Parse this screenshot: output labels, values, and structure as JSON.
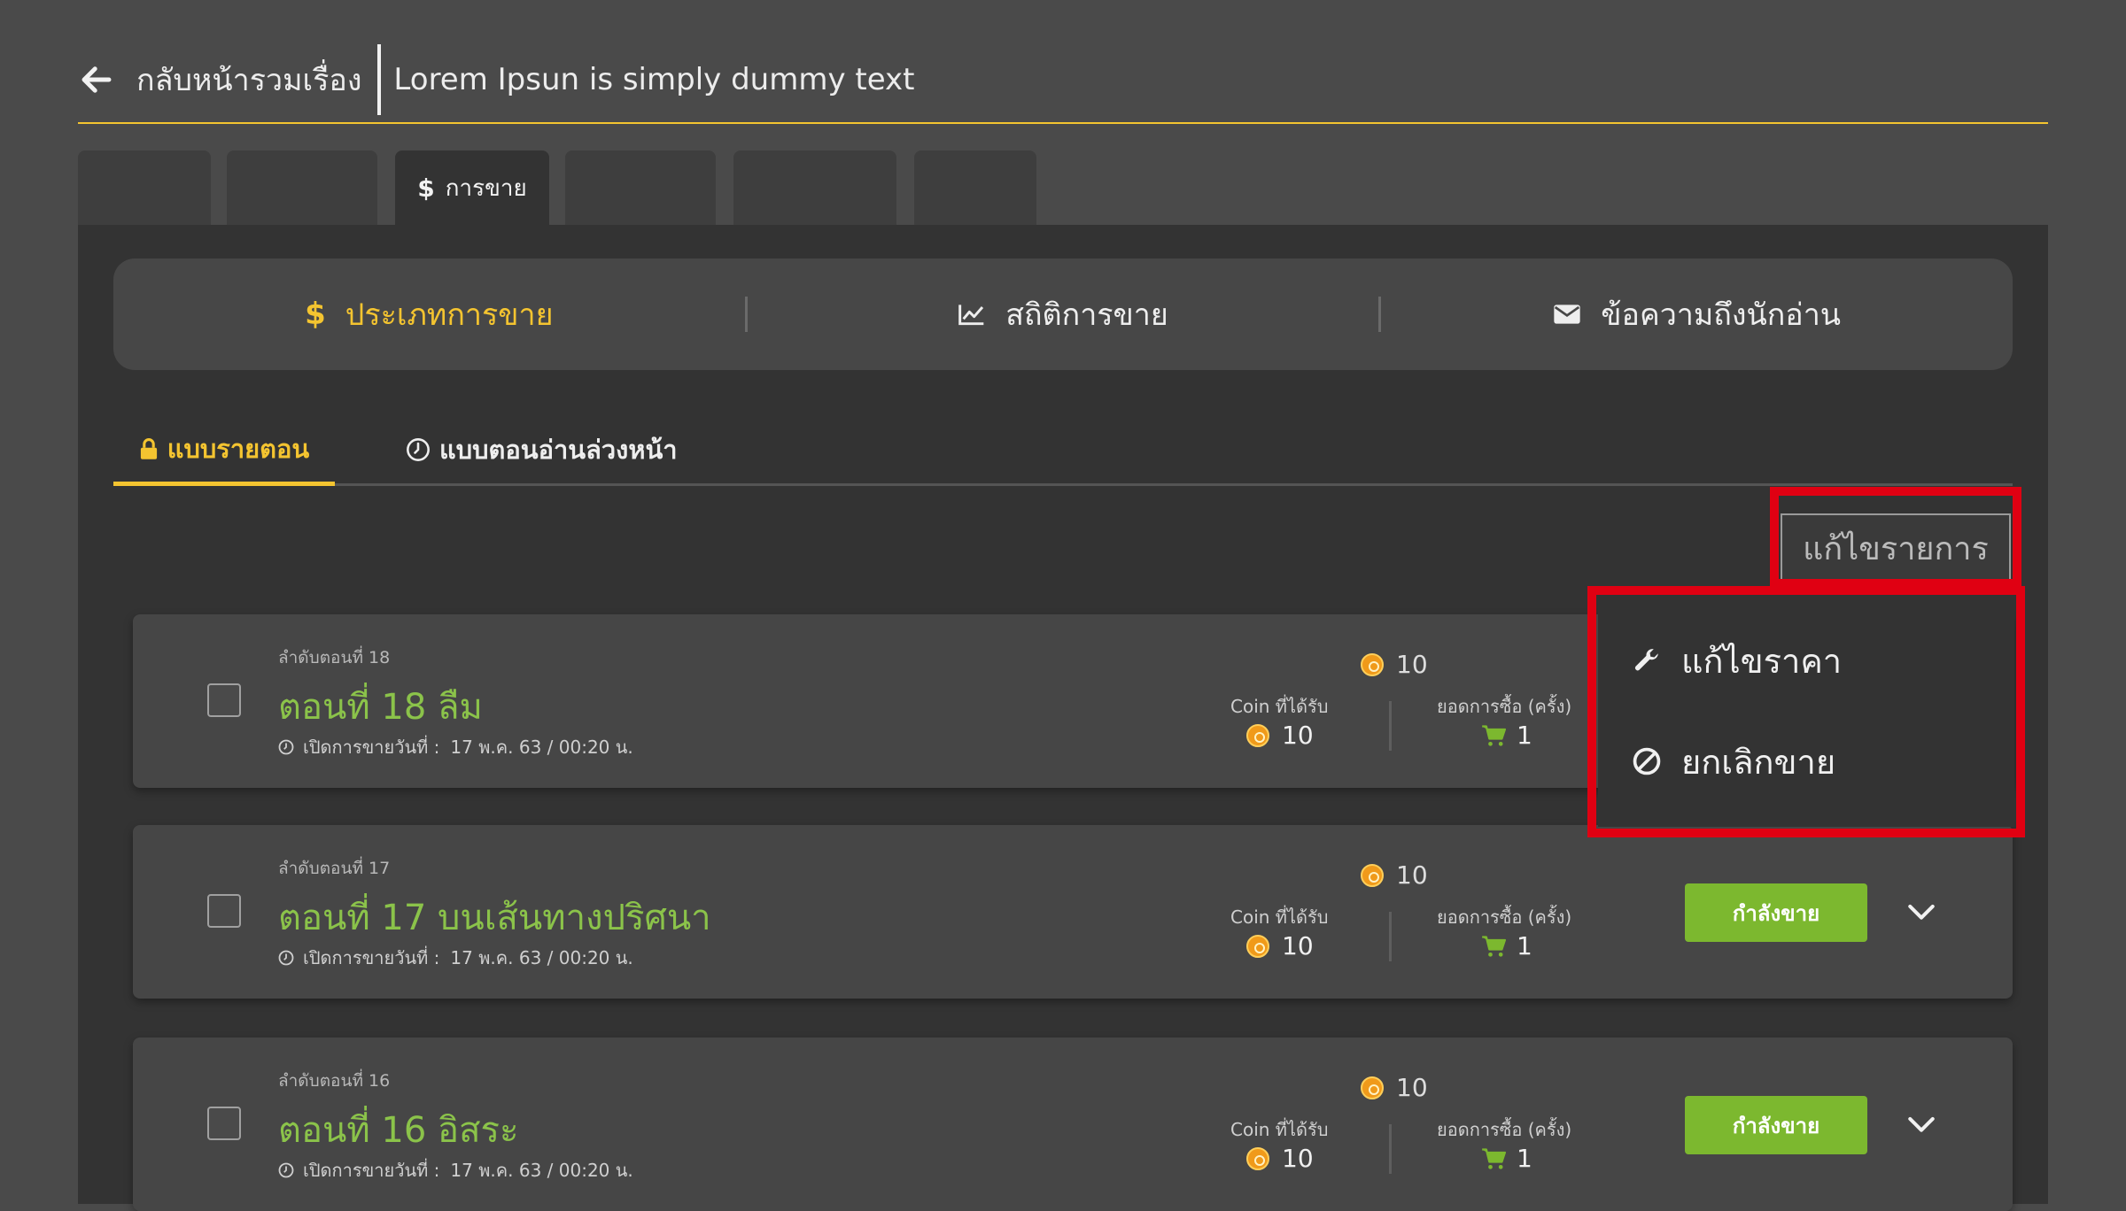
{
  "header": {
    "back_label": "กลับหน้ารวมเรื่อง",
    "title": "Lorem Ipsun is simply dummy text"
  },
  "tabs": [
    {
      "label": ""
    },
    {
      "label": ""
    },
    {
      "label": "การขาย",
      "active": true
    },
    {
      "label": ""
    },
    {
      "label": ""
    },
    {
      "label": ""
    }
  ],
  "segmented": {
    "items": [
      {
        "label": "ประเภทการขาย",
        "icon": "dollar-icon",
        "active": true
      },
      {
        "label": "สถิติการขาย",
        "icon": "chart-icon"
      },
      {
        "label": "ข้อความถึงนักอ่าน",
        "icon": "envelope-icon"
      }
    ]
  },
  "subtabs": [
    {
      "label": "แบบรายตอน",
      "icon": "lock-icon",
      "active": true
    },
    {
      "label": "แบบตอนอ่านล่วงหน้า",
      "icon": "clock-icon"
    }
  ],
  "edit_button": "แก้ไขรายการ",
  "edit_menu": [
    {
      "label": "แก้ไขราคา",
      "icon": "wrench-icon"
    },
    {
      "label": "ยกเลิกขาย",
      "icon": "ban-icon"
    }
  ],
  "labels": {
    "coin_received": "Coin ที่ได้รับ",
    "purchase_count": "ยอดการซื้อ (ครั้ง)",
    "open_date": "เปิดการขายวันที่ :",
    "selling": "กำลังขาย"
  },
  "episodes": [
    {
      "order": "ลำดับตอนที่ 18",
      "title": "ตอนที่ 18 ลืม",
      "date": "17 พ.ค. 63 / 00:20 น.",
      "price": "10",
      "coin": "10",
      "purchases": "1",
      "status": ""
    },
    {
      "order": "ลำดับตอนที่ 17",
      "title": "ตอนที่ 17 บนเส้นทางปริศนา",
      "date": "17 พ.ค. 63 / 00:20 น.",
      "price": "10",
      "coin": "10",
      "purchases": "1",
      "status": "กำลังขาย"
    },
    {
      "order": "ลำดับตอนที่ 16",
      "title": "ตอนที่ 16 อิสระ",
      "date": "17 พ.ค. 63 / 00:20 น.",
      "price": "10",
      "coin": "10",
      "purchases": "1",
      "status": "กำลังขาย"
    }
  ],
  "colors": {
    "accent": "#f4c430",
    "success": "#7cb82f",
    "highlight": "#e00012"
  }
}
